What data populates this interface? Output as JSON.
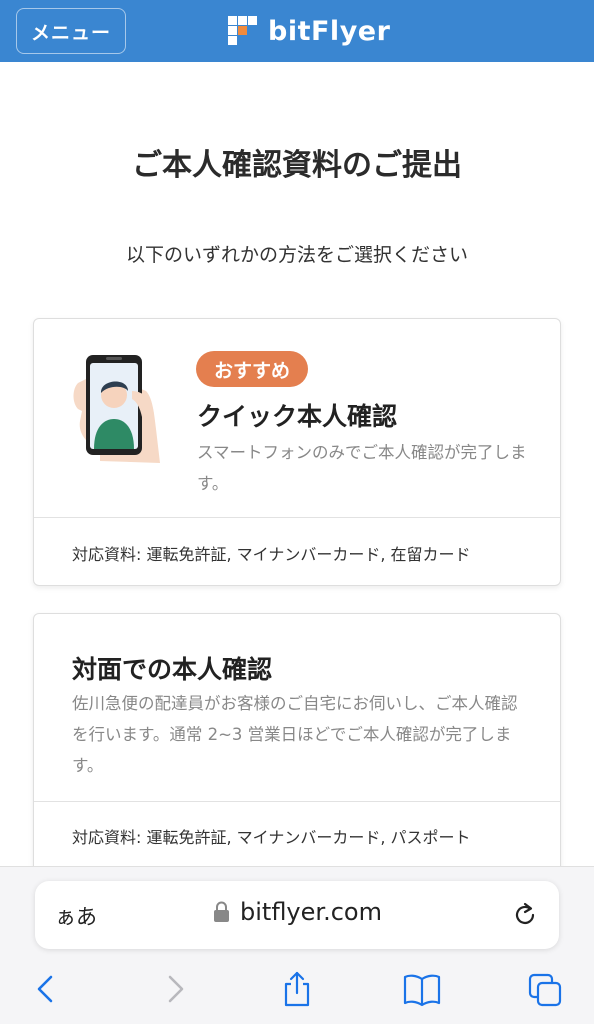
{
  "header": {
    "menu_label": "メニュー",
    "brand_name": "bitFlyer",
    "bg_color": "#3a86d1"
  },
  "page": {
    "title": "ご本人確認資料のご提出",
    "subtitle": "以下のいずれかの方法をご選択ください"
  },
  "options": [
    {
      "badge": "おすすめ",
      "title": "クイック本人確認",
      "description": "スマートフォンのみでご本人確認が完了します。",
      "documents": "対応資料: 運転免許証, マイナンバーカード, 在留カード",
      "icon": "phone-selfie-icon"
    },
    {
      "title": "対面での本人確認",
      "description": "佐川急便の配達員がお客様のご自宅にお伺いし、ご本人確認を行います。通常 2~3 営業日ほどでご本人確認が完了します。",
      "documents": "対応資料: 運転免許証, マイナンバーカード, パスポート"
    }
  ],
  "browser": {
    "aa_label": "ぁあ",
    "url": "bitflyer.com",
    "icons": [
      "lock-icon",
      "reload-icon",
      "back-icon",
      "forward-icon",
      "share-icon",
      "bookmarks-icon",
      "tabs-icon"
    ]
  },
  "colors": {
    "accent": "#3a86d1",
    "badge": "#e47f4f",
    "ios_blue": "#1a73e8"
  }
}
